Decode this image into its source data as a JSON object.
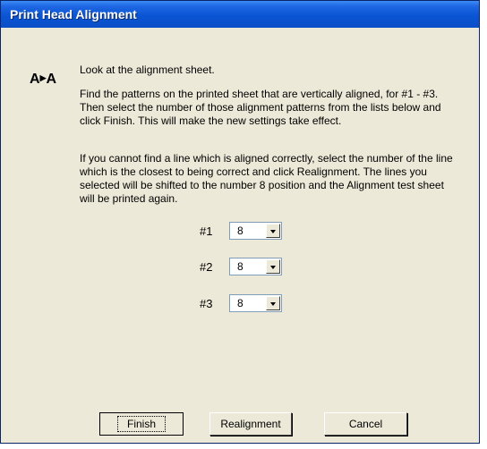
{
  "window": {
    "title": "Print Head Alignment"
  },
  "icon": {
    "name": "alignment-icon",
    "text_left": "A",
    "text_right": "A"
  },
  "instructions": {
    "line1": "Look at the alignment sheet.",
    "para2": "Find the patterns on the printed sheet that are vertically aligned, for #1 - #3. Then select the number of those alignment patterns from the lists below and click Finish. This will make the new settings take effect.",
    "para3": "If you cannot find a line which is aligned correctly, select the number of the line which is the closest to being correct and click Realignment. The lines you selected will be shifted to the number 8 position and the Alignment test sheet will be printed again."
  },
  "selectors": [
    {
      "label": "#1",
      "value": "8"
    },
    {
      "label": "#2",
      "value": "8"
    },
    {
      "label": "#3",
      "value": "8"
    }
  ],
  "buttons": {
    "finish": "Finish",
    "realignment": "Realignment",
    "cancel": "Cancel"
  }
}
